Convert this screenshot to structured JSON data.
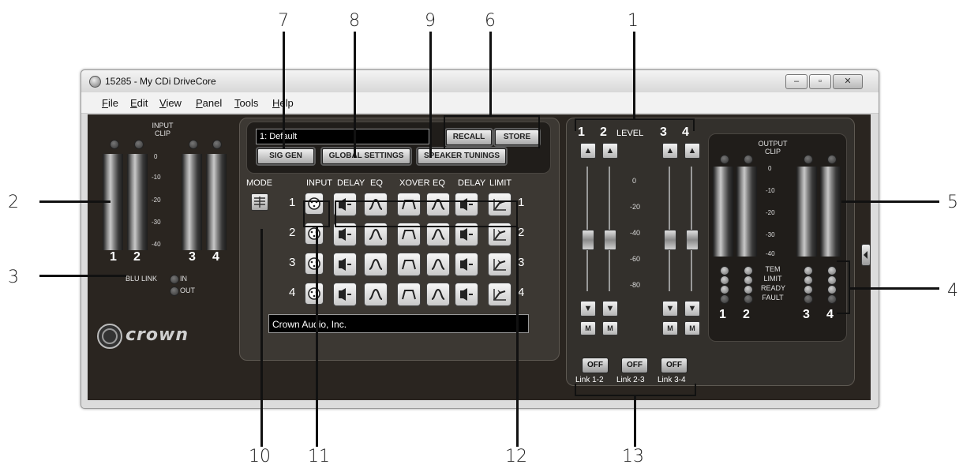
{
  "window": {
    "title": "15285 - My CDi DriveCore",
    "minimize": "–",
    "maximize": "▫",
    "close": "✕"
  },
  "menu": [
    "File",
    "Edit",
    "View",
    "Panel",
    "Tools",
    "Help"
  ],
  "input_meters": {
    "title_line1": "INPUT",
    "title_line2": "CLIP",
    "scale": [
      "0",
      "-10",
      "-20",
      "-30",
      "-40"
    ],
    "channels": [
      "1",
      "2",
      "3",
      "4"
    ],
    "blu_link_label": "BLU LINK",
    "in_label": "IN",
    "out_label": "OUT"
  },
  "brand": {
    "logo_text": "crown",
    "logo_icon": "crown-logo-icon"
  },
  "preset": {
    "value": "1: Default",
    "recall": "RECALL",
    "store": "STORE",
    "sig_gen": "SIG GEN",
    "global_settings": "GLOBAL SETTINGS",
    "speaker_tunings": "SPEAKER TUNINGS"
  },
  "signal_chain": {
    "mode_label": "MODE",
    "headers": [
      "INPUT",
      "DELAY",
      "EQ",
      "XOVER",
      "EQ",
      "DELAY",
      "LIMIT"
    ],
    "rows": [
      "1",
      "2",
      "3",
      "4"
    ],
    "blocks": [
      "input-icon",
      "delay-icon",
      "eq-icon",
      "xover-icon",
      "eq-icon",
      "delay-icon",
      "limit-icon"
    ]
  },
  "status_box": {
    "value": "Crown Audio, Inc."
  },
  "level": {
    "label": "LEVEL",
    "channels": [
      "1",
      "2",
      "3",
      "4"
    ],
    "scale": [
      "0",
      "-20",
      "-40",
      "-60",
      "-80"
    ],
    "mute": "M",
    "up": "▲",
    "down": "▼",
    "links": [
      {
        "state": "OFF",
        "label": "Link 1-2"
      },
      {
        "state": "OFF",
        "label": "Link 2-3"
      },
      {
        "state": "OFF",
        "label": "Link 3-4"
      }
    ]
  },
  "output_meters": {
    "title_line1": "OUTPUT",
    "title_line2": "CLIP",
    "scale": [
      "0",
      "-10",
      "-20",
      "-30",
      "-40"
    ],
    "channels": [
      "1",
      "2",
      "3",
      "4"
    ],
    "status_labels": [
      "TEM",
      "LIMIT",
      "READY",
      "FAULT"
    ]
  },
  "callouts": [
    "1",
    "2",
    "3",
    "4",
    "5",
    "6",
    "7",
    "8",
    "9",
    "10",
    "11",
    "12",
    "13"
  ]
}
